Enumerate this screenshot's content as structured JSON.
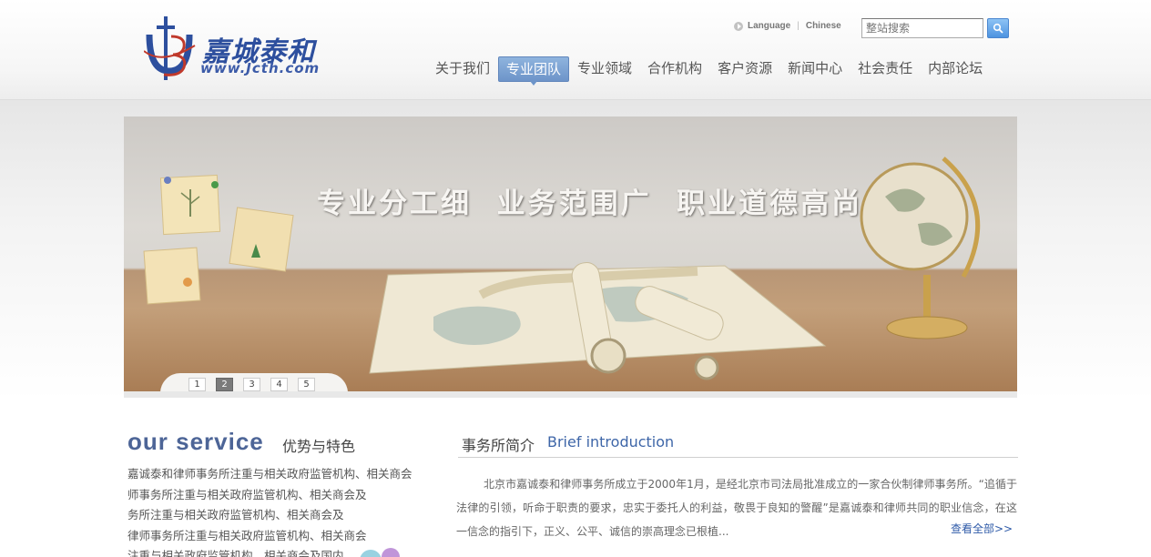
{
  "logo": {
    "cn": "嘉城泰和",
    "url": "www.Jcth.com"
  },
  "header": {
    "language_label": "Language",
    "language_value": "Chinese",
    "search_placeholder": "整站搜索"
  },
  "nav": {
    "items": [
      {
        "label": "关于我们"
      },
      {
        "label": "专业团队"
      },
      {
        "label": "专业领域"
      },
      {
        "label": "合作机构"
      },
      {
        "label": "客户资源"
      },
      {
        "label": "新闻中心"
      },
      {
        "label": "社会责任"
      },
      {
        "label": "内部论坛"
      }
    ],
    "active_label": "专业团队"
  },
  "banner": {
    "slogan": "专业分工细  业务范围广  职业道德高尚",
    "slides": [
      "1",
      "2",
      "3",
      "4",
      "5"
    ],
    "active_slide": "2"
  },
  "service": {
    "title_en": "our service",
    "title_cn": "优势与特色",
    "lines": [
      "嘉诚泰和律师事务所注重与相关政府监管机构、相关商会",
      "师事务所注重与相关政府监管机构、相关商会及",
      "务所注重与相关政府监管机构、相关商会及",
      "律师事务所注重与相关政府监管机构、相关商会",
      "注重与相关政府监管机构、相关商会及国内"
    ]
  },
  "intro": {
    "title_cn": "事务所简介",
    "title_en": "Brief introduction",
    "body": "北京市嘉诚泰和律师事务所成立于2000年1月，是经北京市司法局批准成立的一家合伙制律师事务所。“追循于法律的引领，听命于职责的要求，忠实于委托人的利益，敬畏于良知的警醒”是嘉诚泰和律师共同的职业信念，在这一信念的指引下，正义、公平、诚信的崇高理念已根植...",
    "more": "查看全部>>"
  },
  "colors": {
    "brand_blue": "#2d4f9e",
    "nav_active": "#6d94c9",
    "link": "#2e5aa8"
  }
}
